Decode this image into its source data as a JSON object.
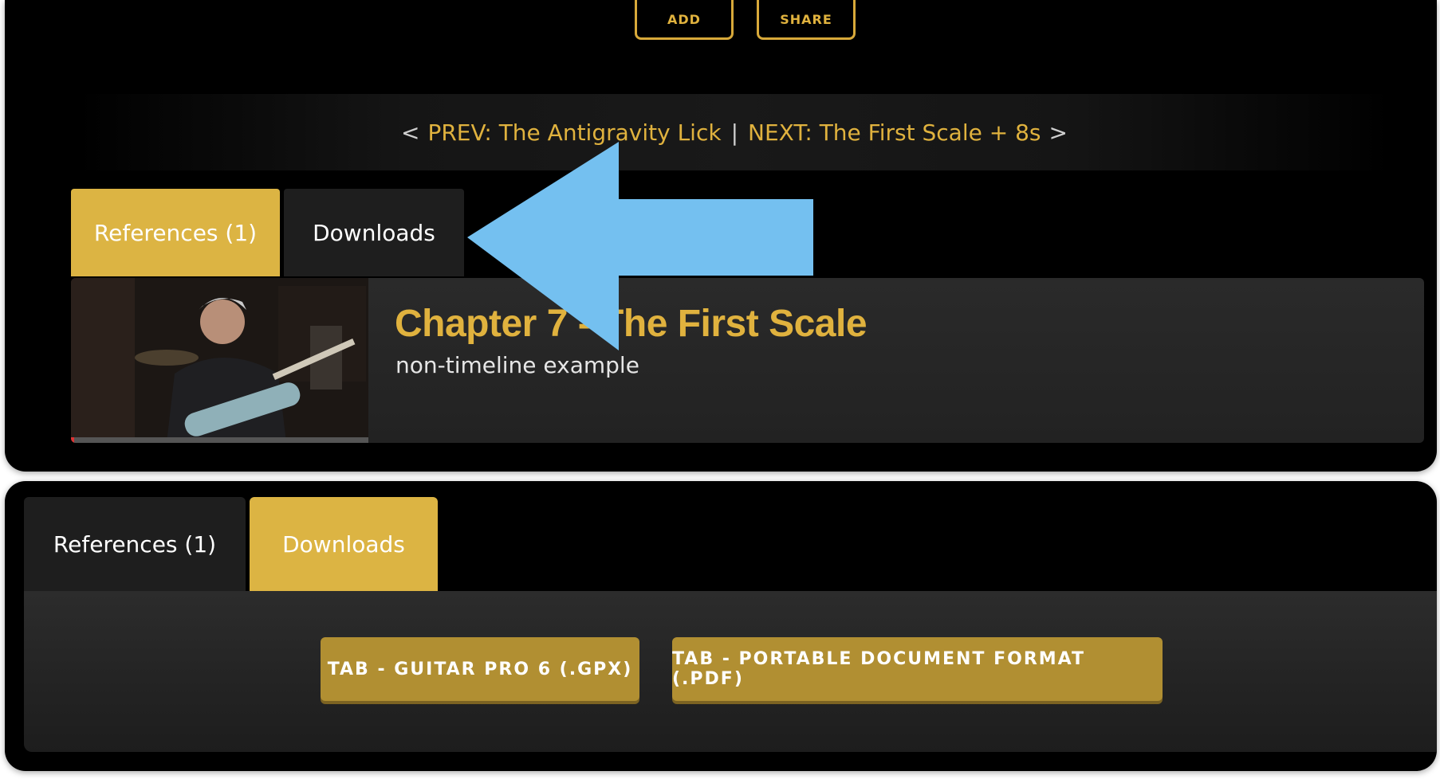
{
  "top_panel": {
    "actions": {
      "add": "ADD",
      "share": "SHARE"
    },
    "nav": {
      "prev_arrow": "<",
      "prev": "PREV: The Antigravity Lick",
      "separator": "|",
      "next": "NEXT: The First Scale + 8s",
      "next_arrow": ">"
    },
    "tabs": [
      {
        "label": "References (1)",
        "active": true
      },
      {
        "label": "Downloads",
        "active": false
      }
    ],
    "reference": {
      "title": "Chapter 7 - The First Scale",
      "subtitle": "non-timeline example",
      "progress_fraction": 0.01
    },
    "annotation": {
      "arrow_color": "#74c0f0",
      "direction": "left"
    }
  },
  "bottom_panel": {
    "tabs": [
      {
        "label": "References (1)",
        "active": false
      },
      {
        "label": "Downloads",
        "active": true
      }
    ],
    "downloads": [
      {
        "label": "TAB - GUITAR PRO 6 (.GPX)"
      },
      {
        "label": "TAB - PORTABLE DOCUMENT FORMAT (.PDF)"
      }
    ]
  },
  "colors": {
    "accent": "#dcb443",
    "button": "#b18f32",
    "background": "#000000"
  }
}
